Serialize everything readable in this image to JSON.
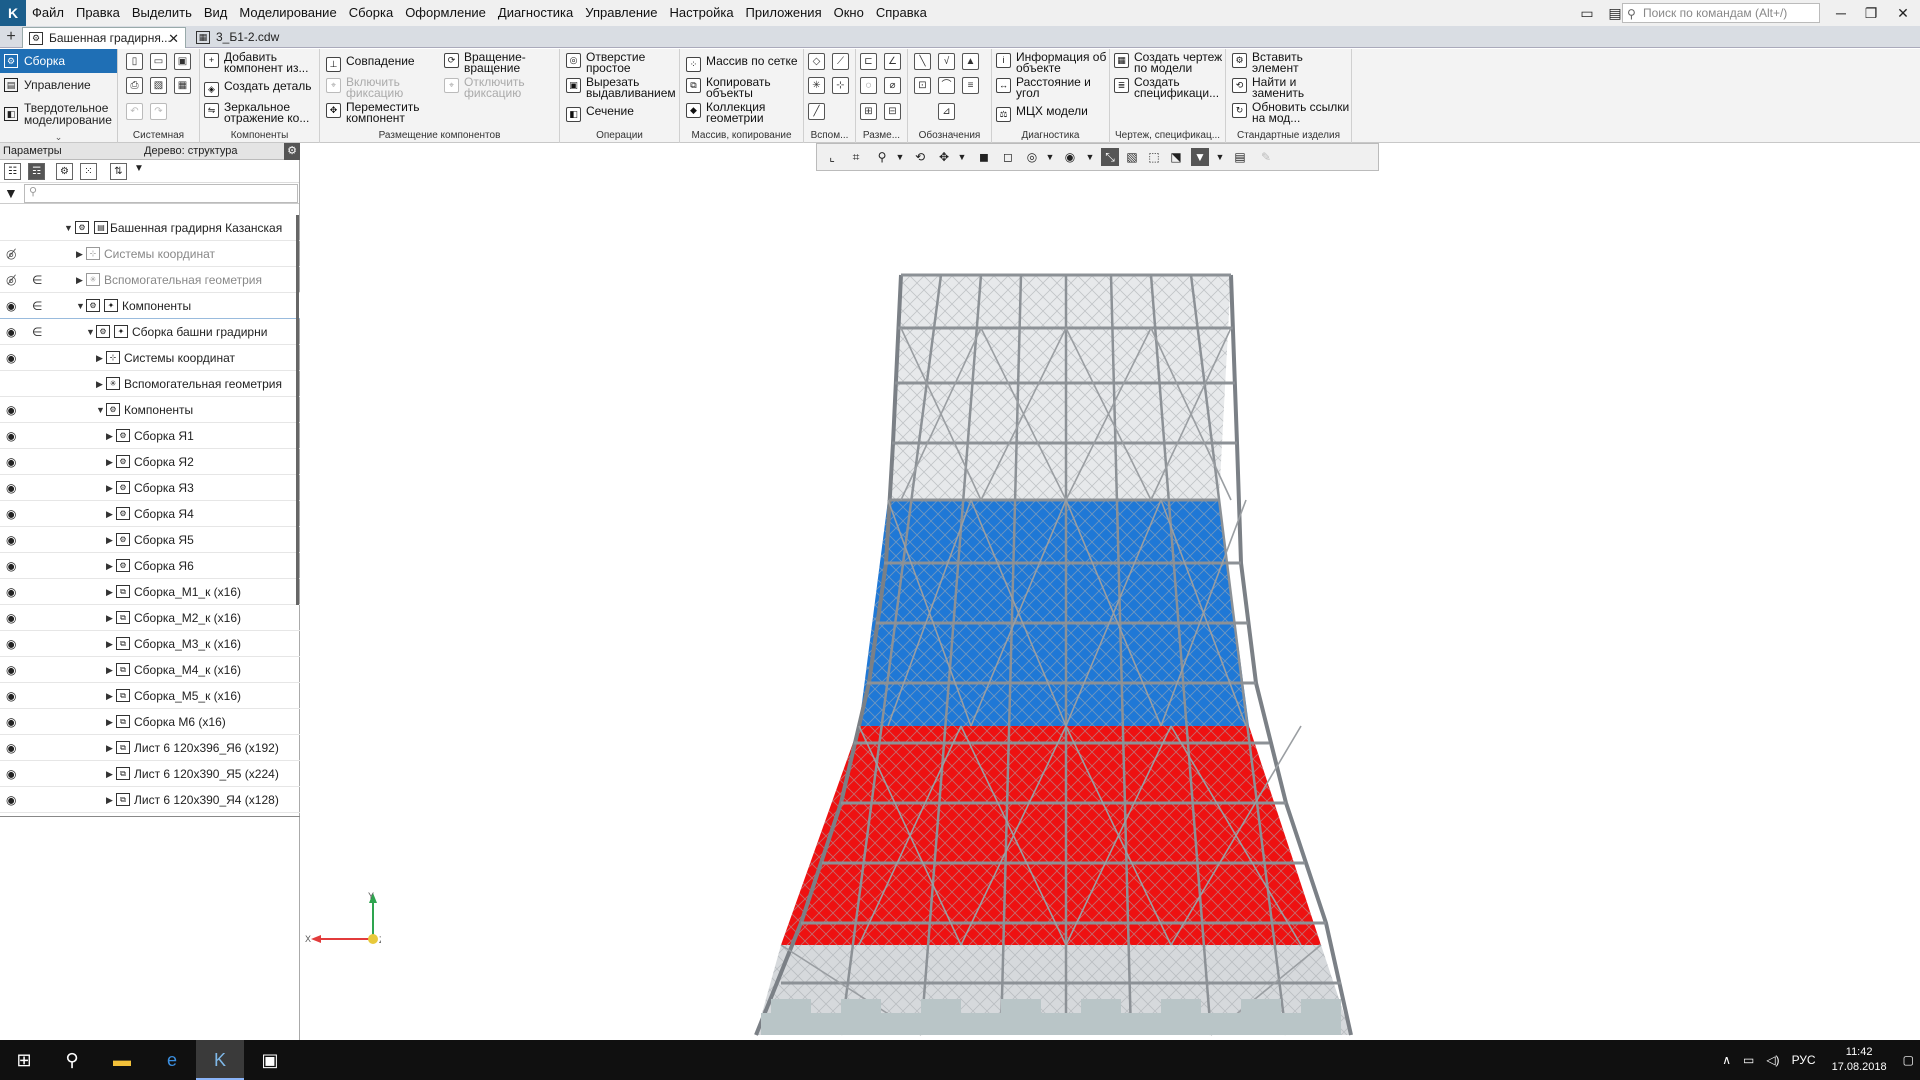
{
  "menu": {
    "items": [
      "Файл",
      "Правка",
      "Выделить",
      "Вид",
      "Моделирование",
      "Сборка",
      "Оформление",
      "Диагностика",
      "Управление",
      "Настройка",
      "Приложения",
      "Окно",
      "Справка"
    ],
    "search_placeholder": "Поиск по командам (Alt+/)"
  },
  "tabs": [
    {
      "label": "Башенная градирня...",
      "close": "✕"
    },
    {
      "label": "3_Б1-2.cdw"
    }
  ],
  "modes": [
    "Сборка",
    "Управление",
    "Твердотельное моделирование"
  ],
  "ribbon": {
    "groups": [
      "Системная",
      "Компоненты",
      "Размещение компонентов",
      "Операции",
      "Массив, копирование",
      "Вспом...",
      "Разме...",
      "Обозначения",
      "Диагностика",
      "Чертеж, спецификац...",
      "Стандартные изделия"
    ],
    "components": [
      "Добавить компонент из...",
      "Создать деталь",
      "Зеркальное отражение ко..."
    ],
    "placement": [
      "Совпадение",
      "Включить фиксацию",
      "Переместить компонент",
      "Вращение-вращение",
      "Отключить фиксацию"
    ],
    "operations": [
      "Отверстие простое",
      "Вырезать выдавливанием",
      "Сечение"
    ],
    "pattern": [
      "Массив по сетке",
      "Копировать объекты",
      "Коллекция геометрии"
    ],
    "diagnostics": [
      "Информация об объекте",
      "Расстояние и угол",
      "МЦХ модели"
    ],
    "drawing": [
      "Создать чертеж по модели",
      "Создать спецификаци..."
    ],
    "standard": [
      "Вставить элемент",
      "Найти и заменить",
      "Обновить ссылки на мод..."
    ]
  },
  "panel": {
    "params_title": "Параметры",
    "tree_title": "Дерево: структура"
  },
  "tree": [
    {
      "label": "Башенная градирня Казанская",
      "eye": "",
      "inc": ""
    },
    {
      "label": "Системы координат",
      "eye": "hidden",
      "inc": ""
    },
    {
      "label": "Вспомогательная геометрия",
      "eye": "hidden",
      "inc": "∈"
    },
    {
      "label": "Компоненты",
      "eye": "visible",
      "inc": "∈"
    },
    {
      "label": "Сборка башни градирни",
      "eye": "visible",
      "inc": "∈"
    },
    {
      "label": "Системы координат",
      "eye": "visible",
      "inc": ""
    },
    {
      "label": "Вспомогательная геометрия",
      "eye": "",
      "inc": ""
    },
    {
      "label": "Компоненты",
      "eye": "visible",
      "inc": ""
    },
    {
      "label": "Сборка Я1",
      "eye": "visible",
      "inc": ""
    },
    {
      "label": "Сборка Я2",
      "eye": "visible",
      "inc": ""
    },
    {
      "label": "Сборка Я3",
      "eye": "visible",
      "inc": ""
    },
    {
      "label": "Сборка Я4",
      "eye": "visible",
      "inc": ""
    },
    {
      "label": "Сборка Я5",
      "eye": "visible",
      "inc": ""
    },
    {
      "label": "Сборка Я6",
      "eye": "visible",
      "inc": ""
    },
    {
      "label": "Сборка_М1_к (х16)",
      "eye": "visible",
      "inc": ""
    },
    {
      "label": "Сборка_М2_к (х16)",
      "eye": "visible",
      "inc": ""
    },
    {
      "label": "Сборка_М3_к (х16)",
      "eye": "visible",
      "inc": ""
    },
    {
      "label": "Сборка_М4_к (х16)",
      "eye": "visible",
      "inc": ""
    },
    {
      "label": "Сборка_М5_к (х16)",
      "eye": "visible",
      "inc": ""
    },
    {
      "label": "Сборка М6 (х16)",
      "eye": "visible",
      "inc": ""
    },
    {
      "label": "Лист 6 120х396_Я6 (х192)",
      "eye": "visible",
      "inc": ""
    },
    {
      "label": "Лист 6 120х390_Я5 (х224)",
      "eye": "visible",
      "inc": ""
    },
    {
      "label": "Лист 6 120х390_Я4 (х128)",
      "eye": "visible",
      "inc": ""
    }
  ],
  "axes": {
    "x": "X",
    "y": "Y",
    "z": "Z"
  },
  "taskbar": {
    "lang": "РУС",
    "time": "11:42",
    "date": "17.08.2018"
  },
  "colors": {
    "accent": "#1f6fb5",
    "band_blue": "#1f78d6",
    "band_red": "#ee1111",
    "steel": "#8c9196"
  }
}
